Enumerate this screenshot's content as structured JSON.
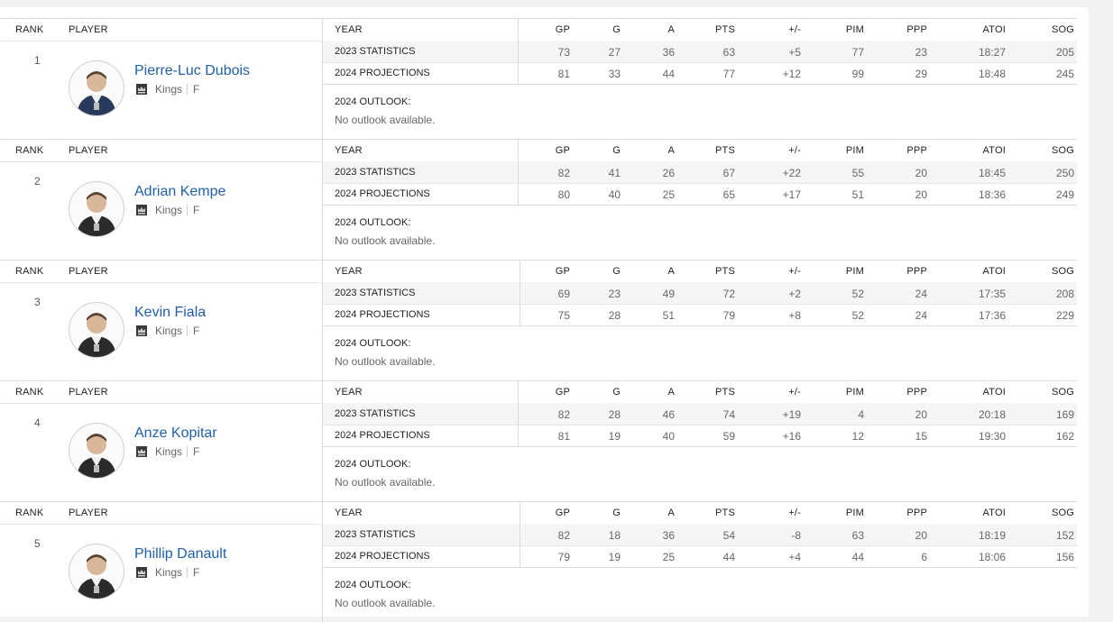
{
  "headers": {
    "rank": "RANK",
    "player": "PLAYER",
    "cols": [
      "YEAR",
      "GP",
      "G",
      "A",
      "PTS",
      "+/-",
      "PIM",
      "PPP",
      "ATOI",
      "SOG"
    ]
  },
  "row_labels": [
    "2023 STATISTICS",
    "2024 PROJECTIONS"
  ],
  "outlook_label": "2024 OUTLOOK:",
  "players": [
    {
      "rank": "1",
      "name": "Pierre-Luc Dubois",
      "team": "Kings",
      "pos": "F",
      "stats": [
        [
          "73",
          "27",
          "36",
          "63",
          "+5",
          "77",
          "23",
          "18:27",
          "205"
        ],
        [
          "81",
          "33",
          "44",
          "77",
          "+12",
          "99",
          "29",
          "18:48",
          "245"
        ]
      ],
      "outlook": "No outlook available."
    },
    {
      "rank": "2",
      "name": "Adrian Kempe",
      "team": "Kings",
      "pos": "F",
      "stats": [
        [
          "82",
          "41",
          "26",
          "67",
          "+22",
          "55",
          "20",
          "18:45",
          "250"
        ],
        [
          "80",
          "40",
          "25",
          "65",
          "+17",
          "51",
          "20",
          "18:36",
          "249"
        ]
      ],
      "outlook": "No outlook available."
    },
    {
      "rank": "3",
      "name": "Kevin Fiala",
      "team": "Kings",
      "pos": "F",
      "stats": [
        [
          "69",
          "23",
          "49",
          "72",
          "+2",
          "52",
          "24",
          "17:35",
          "208"
        ],
        [
          "75",
          "28",
          "51",
          "79",
          "+8",
          "52",
          "24",
          "17:36",
          "229"
        ]
      ],
      "outlook": "No outlook available."
    },
    {
      "rank": "4",
      "name": "Anze Kopitar",
      "team": "Kings",
      "pos": "F",
      "stats": [
        [
          "82",
          "28",
          "46",
          "74",
          "+19",
          "4",
          "20",
          "20:18",
          "169"
        ],
        [
          "81",
          "19",
          "40",
          "59",
          "+16",
          "12",
          "15",
          "19:30",
          "162"
        ]
      ],
      "outlook": "No outlook available."
    },
    {
      "rank": "5",
      "name": "Phillip Danault",
      "team": "Kings",
      "pos": "F",
      "stats": [
        [
          "82",
          "18",
          "36",
          "54",
          "-8",
          "63",
          "20",
          "18:19",
          "152"
        ],
        [
          "79",
          "19",
          "25",
          "44",
          "+4",
          "44",
          "6",
          "18:06",
          "156"
        ]
      ],
      "outlook": "No outlook available."
    }
  ],
  "icons": {
    "team_logo": "kings-crown-logo-icon",
    "avatar": "player-headshot-icon"
  },
  "colors": {
    "link": "#1f5fa8",
    "border": "#dcdcdc",
    "stripe": "#f5f5f5"
  }
}
